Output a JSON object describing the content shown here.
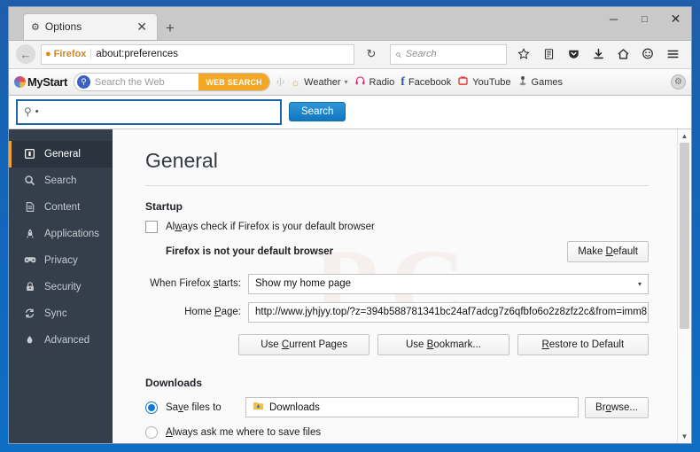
{
  "window": {
    "tab_title": "Options",
    "tab_icon": "gear-icon",
    "close_tab_glyph": "✕",
    "new_tab_glyph": "+",
    "minimize_glyph": "─",
    "maximize_glyph": "□",
    "close_glyph": "✕"
  },
  "navbar": {
    "back_glyph": "←",
    "brand": "Firefox",
    "url": "about:preferences",
    "reload_glyph": "↻",
    "search_placeholder": "Search",
    "search_glyph": "⌕",
    "icons": [
      {
        "name": "bookmark-star-icon",
        "glyph": "☆"
      },
      {
        "name": "library-icon",
        "glyph": "▤"
      },
      {
        "name": "pocket-icon",
        "glyph": "▼"
      },
      {
        "name": "downloads-icon",
        "glyph": "↓"
      },
      {
        "name": "home-icon",
        "glyph": "⌂"
      },
      {
        "name": "chat-icon",
        "glyph": "☺"
      },
      {
        "name": "menu-icon",
        "glyph": "☰"
      }
    ]
  },
  "mystart": {
    "logo": "MyStart",
    "search_placeholder": "Search the Web",
    "search_glyph": "⚲",
    "web_search_label": "WEB SEARCH",
    "separator": "‹|›",
    "items": [
      {
        "name": "weather",
        "label": "Weather",
        "icon": "sun-icon",
        "glyph": "☀",
        "color": "#f0a32a",
        "caret": "▾"
      },
      {
        "name": "radio",
        "label": "Radio",
        "icon": "headphones-icon",
        "glyph": "♫",
        "color": "#e0216f"
      },
      {
        "name": "facebook",
        "label": "Facebook",
        "icon": "facebook-icon",
        "glyph": "f",
        "color": "#3b5998"
      },
      {
        "name": "youtube",
        "label": "YouTube",
        "icon": "youtube-icon",
        "glyph": "▶",
        "color": "#e02020"
      },
      {
        "name": "games",
        "label": "Games",
        "icon": "joystick-icon",
        "glyph": "♟",
        "color": "#5a5a5a"
      }
    ],
    "gear_glyph": "⚙"
  },
  "injected_search": {
    "magnifier_glyph": "⚲",
    "value": "",
    "dot": "•",
    "button_label": "Search"
  },
  "sidebar": {
    "items": [
      {
        "label": "General",
        "icon": "general-icon",
        "glyph": "☰",
        "active": true
      },
      {
        "label": "Search",
        "icon": "search-icon",
        "glyph": "⚲",
        "active": false
      },
      {
        "label": "Content",
        "icon": "content-icon",
        "glyph": "☷",
        "active": false
      },
      {
        "label": "Applications",
        "icon": "applications-icon",
        "glyph": "✈",
        "active": false
      },
      {
        "label": "Privacy",
        "icon": "privacy-mask-icon",
        "glyph": "⚫",
        "active": false
      },
      {
        "label": "Security",
        "icon": "lock-icon",
        "glyph": "⚿",
        "active": false
      },
      {
        "label": "Sync",
        "icon": "sync-icon",
        "glyph": "↻",
        "active": false
      },
      {
        "label": "Advanced",
        "icon": "advanced-icon",
        "glyph": "◈",
        "active": false
      }
    ]
  },
  "main": {
    "title": "General",
    "startup": {
      "heading": "Startup",
      "default_check_label_pre": "Al",
      "default_check_label_accel": "w",
      "default_check_label_post": "ays check if Firefox is your default browser",
      "default_check_checked": false,
      "not_default_text": "Firefox is not your default browser",
      "make_default_pre": "Make ",
      "make_default_accel": "D",
      "make_default_post": "efault",
      "when_starts_label_pre": "When Firefox ",
      "when_starts_label_accel": "s",
      "when_starts_label_post": "tarts:",
      "when_starts_value": "Show my home page",
      "caret_glyph": "▾",
      "home_page_label_pre": "Home ",
      "home_page_label_accel": "P",
      "home_page_label_post": "age:",
      "home_page_value": "http://www.jyhjyy.top/?z=394b588781341bc24af7adcg7z6qfbfo6o2z8zfz2c&from=imm8",
      "buttons": [
        {
          "name": "use-current-pages",
          "pre": "Use ",
          "accel": "C",
          "post": "urrent Pages"
        },
        {
          "name": "use-bookmark",
          "pre": "Use ",
          "accel": "B",
          "post": "ookmark..."
        },
        {
          "name": "restore-to-default",
          "pre": "",
          "accel": "R",
          "post": "estore to Default"
        }
      ]
    },
    "downloads": {
      "heading": "Downloads",
      "save_to_label_pre": "Sa",
      "save_to_label_accel": "v",
      "save_to_label_post": "e files to",
      "save_to_selected": true,
      "folder_value": "Downloads",
      "folder_icon": "folder-download-icon",
      "browse_pre": "Br",
      "browse_accel": "o",
      "browse_post": "wse...",
      "always_ask_label_pre": "",
      "always_ask_label_accel": "A",
      "always_ask_label_post": "lways ask me where to save files",
      "always_ask_selected": false
    }
  },
  "scrollbar": {
    "up_glyph": "▲",
    "down_glyph": "▼"
  },
  "watermark": {
    "text": "PC"
  },
  "colors": {
    "frame_blue": "#0d6ec4",
    "sidebar_bg": "#343f4b",
    "accent_orange": "#f0a030",
    "radio_blue": "#1478d0",
    "websearch_orange": "#f5a623",
    "search_button_blue": "#1277bf"
  }
}
